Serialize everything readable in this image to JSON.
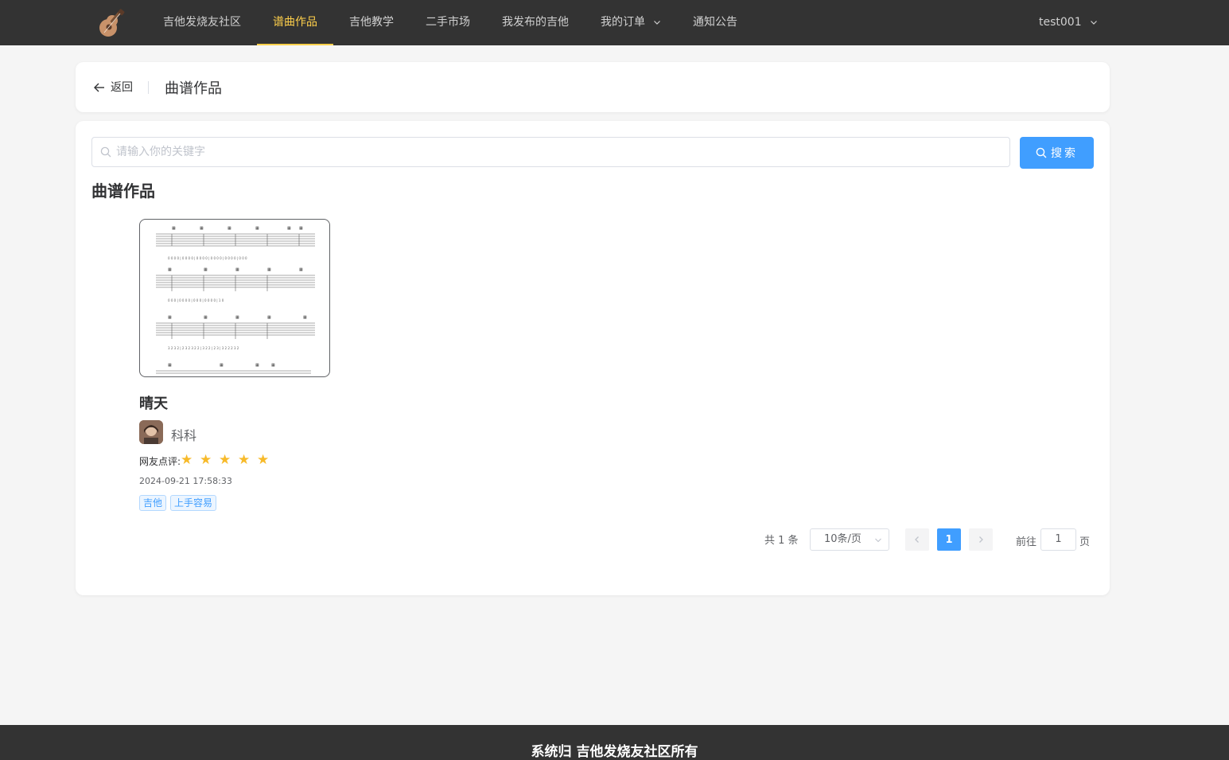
{
  "nav": {
    "logo_icon": "guitar-logo-icon",
    "items": [
      {
        "label": "吉他发烧友社区"
      },
      {
        "label": "谱曲作品"
      },
      {
        "label": "吉他教学"
      },
      {
        "label": "二手市场"
      },
      {
        "label": "我发布的吉他"
      },
      {
        "label": "我的订单"
      },
      {
        "label": "通知公告"
      }
    ],
    "active_index": 1,
    "user": "test001",
    "active_color": "#ffd04b"
  },
  "header": {
    "back_label": "返回",
    "title": "曲谱作品"
  },
  "search": {
    "placeholder": "请输入你的关键字",
    "value": "",
    "button_label": "搜索"
  },
  "section": {
    "title": "曲谱作品"
  },
  "works": [
    {
      "title": "晴天",
      "author": "科科",
      "rating_label": "网友点评:",
      "rating": 5,
      "rating_max": 5,
      "datetime": "2024-09-21 17:58:33",
      "tags": [
        "吉他",
        "上手容易"
      ]
    }
  ],
  "pagination": {
    "total_text": "共 1 条",
    "page_size_label": "10条/页",
    "current_page": "1",
    "goto_label": "前往",
    "goto_value": "1",
    "goto_suffix": "页"
  },
  "footer": {
    "text": "系统归 吉他发烧友社区所有"
  },
  "colors": {
    "primary": "#409eff",
    "topbar": "#333333",
    "star": "#f7ba2a"
  }
}
